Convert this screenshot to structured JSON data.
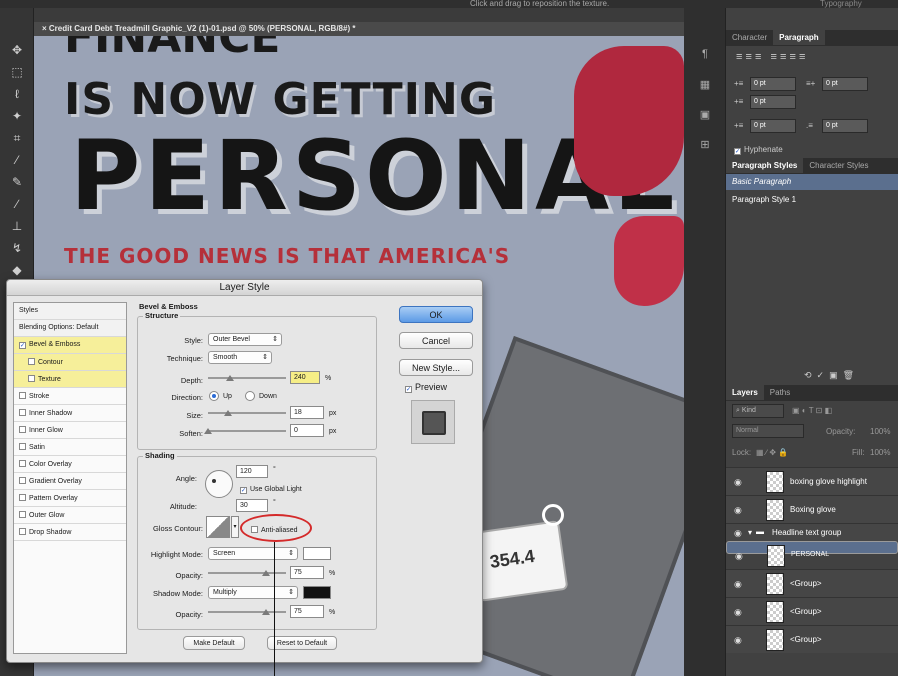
{
  "option_bar": {
    "hint": "Click and drag to reposition the texture.",
    "workspace": "Typography"
  },
  "document": {
    "tab_title": "Credit Card Debt Treadmill Graphic_V2 (1)-01.psd @ 50% (PERSONAL, RGB/8#) *",
    "headline_top": "FINANCE",
    "headline_line1": "IS NOW GETTING",
    "headline_line2": "PERSONAL",
    "subhead": "THE GOOD NEWS IS THAT AMERICA'S",
    "tag_value": "354.4"
  },
  "paragraph_panel": {
    "tabs": [
      "Character",
      "Paragraph"
    ],
    "indent_left": "0 pt",
    "indent_right": "0 pt",
    "first_line": "0 pt",
    "space_before": "0 pt",
    "space_after": "0 pt",
    "hyphenate": "Hyphenate"
  },
  "paragraph_styles": {
    "tabs": [
      "Paragraph Styles",
      "Character Styles"
    ],
    "items": [
      "Basic Paragraph",
      "Paragraph Style 1"
    ]
  },
  "layers_panel": {
    "tabs": [
      "Layers",
      "Paths"
    ],
    "kind": "Kind",
    "blend_mode": "Normal",
    "opacity_label": "Opacity:",
    "opacity_value": "100%",
    "lock_label": "Lock:",
    "fill_label": "Fill:",
    "fill_value": "100%",
    "layers": [
      {
        "name": "boxing glove highlight",
        "selected": false
      },
      {
        "name": "Boxing glove",
        "selected": false
      },
      {
        "name": "Headline text group",
        "selected": false,
        "group": true
      },
      {
        "name": "PERSONAL",
        "selected": true
      },
      {
        "name": "<Group>",
        "selected": false
      },
      {
        "name": "<Group>",
        "selected": false
      },
      {
        "name": "<Group>",
        "selected": false
      }
    ]
  },
  "dialog": {
    "title": "Layer Style",
    "styles_header": "Styles",
    "blending_options": "Blending Options: Default",
    "style_items": [
      {
        "label": "Bevel & Emboss",
        "checked": true,
        "highlight": true,
        "indent": false
      },
      {
        "label": "Contour",
        "checked": false,
        "highlight": true,
        "indent": true
      },
      {
        "label": "Texture",
        "checked": false,
        "highlight": true,
        "indent": true
      },
      {
        "label": "Stroke",
        "checked": false,
        "highlight": false,
        "indent": false
      },
      {
        "label": "Inner Shadow",
        "checked": false,
        "highlight": false,
        "indent": false
      },
      {
        "label": "Inner Glow",
        "checked": false,
        "highlight": false,
        "indent": false
      },
      {
        "label": "Satin",
        "checked": false,
        "highlight": false,
        "indent": false
      },
      {
        "label": "Color Overlay",
        "checked": false,
        "highlight": false,
        "indent": false
      },
      {
        "label": "Gradient Overlay",
        "checked": false,
        "highlight": false,
        "indent": false
      },
      {
        "label": "Pattern Overlay",
        "checked": false,
        "highlight": false,
        "indent": false
      },
      {
        "label": "Outer Glow",
        "checked": false,
        "highlight": false,
        "indent": false
      },
      {
        "label": "Drop Shadow",
        "checked": false,
        "highlight": false,
        "indent": false
      }
    ],
    "section_title": "Bevel & Emboss",
    "structure_title": "Structure",
    "style_label": "Style:",
    "style_value": "Outer Bevel",
    "technique_label": "Technique:",
    "technique_value": "Smooth",
    "depth_label": "Depth:",
    "depth_value": "240",
    "depth_unit": "%",
    "direction_label": "Direction:",
    "direction_up": "Up",
    "direction_down": "Down",
    "size_label": "Size:",
    "size_value": "18",
    "size_unit": "px",
    "soften_label": "Soften:",
    "soften_value": "0",
    "soften_unit": "px",
    "shading_title": "Shading",
    "angle_label": "Angle:",
    "angle_value": "120",
    "angle_unit": "°",
    "global_light": "Use Global Light",
    "altitude_label": "Altitude:",
    "altitude_value": "30",
    "altitude_unit": "°",
    "gloss_label": "Gloss Contour:",
    "anti_aliased": "Anti-aliased",
    "highlight_mode_label": "Highlight Mode:",
    "highlight_mode_value": "Screen",
    "highlight_opacity_label": "Opacity:",
    "highlight_opacity_value": "75",
    "shadow_mode_label": "Shadow Mode:",
    "shadow_mode_value": "Multiply",
    "shadow_opacity_label": "Opacity:",
    "shadow_opacity_value": "75",
    "opacity_unit": "%",
    "make_default": "Make Default",
    "reset_default": "Reset to Default",
    "ok": "OK",
    "cancel": "Cancel",
    "new_style": "New Style...",
    "preview": "Preview"
  }
}
